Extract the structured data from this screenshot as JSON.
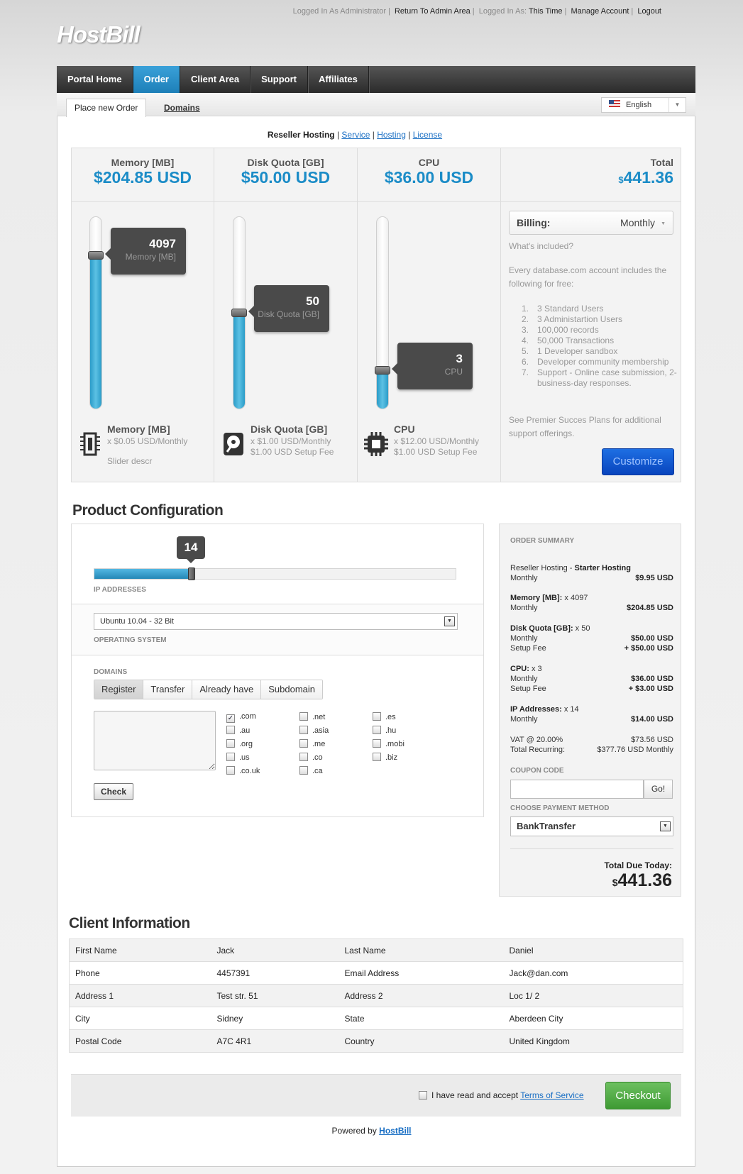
{
  "top_links": {
    "logged_in_as": "Logged In As Administrator",
    "return_admin": "Return To Admin Area",
    "logged_in_as2": "Logged In As:",
    "this_time": "This Time",
    "manage_account": "Manage Account",
    "logout": "Logout"
  },
  "logo": "HostBill",
  "nav": [
    "Portal Home",
    "Order",
    "Client Area",
    "Support",
    "Affiliates"
  ],
  "subtabs": {
    "place_order": "Place new Order",
    "domains": "Domains"
  },
  "language": "English",
  "breadcrumb": {
    "current": "Reseller Hosting",
    "links": [
      "Service",
      "Hosting",
      "License"
    ]
  },
  "resources": [
    {
      "title": "Memory [MB]",
      "price": "$204.85 USD",
      "value": "4097",
      "unit": "Memory [MB]",
      "level": 0.8,
      "name": "Memory [MB]",
      "desc1": "x $0.05 USD/Monthly",
      "desc2": "",
      "extra": "Slider descr",
      "icon": "memory-chip-icon"
    },
    {
      "title": "Disk Quota [GB]",
      "price": "$50.00 USD",
      "value": "50",
      "unit": "Disk Quota [GB]",
      "level": 0.5,
      "name": "Disk Quota [GB]",
      "desc1": "x $1.00 USD/Monthly",
      "desc2": "$1.00 USD Setup Fee",
      "extra": "",
      "icon": "hard-disk-icon"
    },
    {
      "title": "CPU",
      "price": "$36.00 USD",
      "value": "3",
      "unit": "CPU",
      "level": 0.2,
      "name": "CPU",
      "desc1": "x $12.00 USD/Monthly",
      "desc2": "$1.00 USD Setup Fee",
      "extra": "",
      "icon": "cpu-icon"
    }
  ],
  "total": {
    "label": "Total",
    "currency": "$",
    "amount": "441.36"
  },
  "billing": {
    "label": "Billing:",
    "value": "Monthly"
  },
  "included": {
    "question": "What's included?",
    "intro": "Every database.com account includes the following for free:",
    "items": [
      "3 Standard Users",
      "3 Administartion Users",
      "100,000 records",
      "50,000 Transactions",
      "1 Developer sandbox",
      "Developer community membership",
      "Support - Online case submission, 2-business-day responses."
    ],
    "outro": "See Premier Succes Plans for additional support offerings."
  },
  "customize_label": "Customize",
  "product_config": {
    "title": "Product Configuration",
    "ip": {
      "value": "14",
      "label": "IP ADDRESSES",
      "level": 0.27
    },
    "os": {
      "value": "Ubuntu 10.04 - 32 Bit",
      "label": "OPERATING SYSTEM"
    },
    "domains": {
      "label": "DOMAINS",
      "tabs": [
        "Register",
        "Transfer",
        "Already have",
        "Subdomain"
      ],
      "tlds": [
        {
          "name": ".com",
          "checked": true
        },
        {
          "name": ".net",
          "checked": false
        },
        {
          "name": ".es",
          "checked": false
        },
        {
          "name": ".au",
          "checked": false
        },
        {
          "name": ".asia",
          "checked": false
        },
        {
          "name": ".hu",
          "checked": false
        },
        {
          "name": ".org",
          "checked": false
        },
        {
          "name": ".me",
          "checked": false
        },
        {
          "name": ".mobi",
          "checked": false
        },
        {
          "name": ".us",
          "checked": false
        },
        {
          "name": ".co",
          "checked": false
        },
        {
          "name": ".biz",
          "checked": false
        },
        {
          "name": ".co.uk",
          "checked": false
        },
        {
          "name": ".ca",
          "checked": false
        }
      ],
      "check_label": "Check"
    }
  },
  "order_summary": {
    "title": "ORDER SUMMARY",
    "product_prefix": "Reseller Hosting - ",
    "product_name": "Starter Hosting",
    "product_cycle": "Monthly",
    "product_price": "$9.95 USD",
    "memory_label": "Memory [MB]:",
    "memory_qty": " x 4097",
    "memory_cycle": "Monthly",
    "memory_price": "$204.85 USD",
    "disk_label": "Disk Quota [GB]:",
    "disk_qty": " x 50",
    "disk_cycle": "Monthly",
    "disk_price": "$50.00 USD",
    "disk_setup": "Setup Fee",
    "disk_setup_price": "+ $50.00 USD",
    "cpu_label": "CPU:",
    "cpu_qty": " x 3",
    "cpu_cycle": "Monthly",
    "cpu_price": "$36.00 USD",
    "cpu_setup": "Setup Fee",
    "cpu_setup_price": "+ $3.00 USD",
    "ip_label": "IP Addresses:",
    "ip_qty": " x 14",
    "ip_cycle": "Monthly",
    "ip_price": "$14.00 USD",
    "vat_label": "VAT @ 20.00%",
    "vat_price": "$73.56 USD",
    "recurring_label": "Total Recurring:",
    "recurring_price": "$377.76 USD Monthly",
    "coupon_label": "COUPON CODE",
    "go_label": "Go!",
    "payment_label": "CHOOSE PAYMENT METHOD",
    "payment_value": "BankTransfer",
    "due_label": "Total Due Today:",
    "due_currency": "$",
    "due_amount": "441.36"
  },
  "client_info": {
    "title": "Client Information",
    "rows": [
      [
        "First Name",
        "Jack",
        "Last Name",
        "Daniel"
      ],
      [
        "Phone",
        "4457391",
        "Email Address",
        "Jack@dan.com"
      ],
      [
        "Address 1",
        "Test str. 51",
        "Address 2",
        "Loc 1/ 2"
      ],
      [
        "City",
        "Sidney",
        "State",
        "Aberdeen City"
      ],
      [
        "Postal Code",
        "A7C 4R1",
        "Country",
        "United Kingdom"
      ]
    ]
  },
  "terms": {
    "text": "I have read and accept ",
    "link": "Terms of Service"
  },
  "checkout_label": "Checkout",
  "powered": {
    "text": "Powered by ",
    "link": "HostBill"
  },
  "colors": {
    "accent": "#1b8cc7",
    "nav_active": "#2a90c8",
    "customize": "#0b4fcf",
    "checkout": "#4fae43"
  }
}
